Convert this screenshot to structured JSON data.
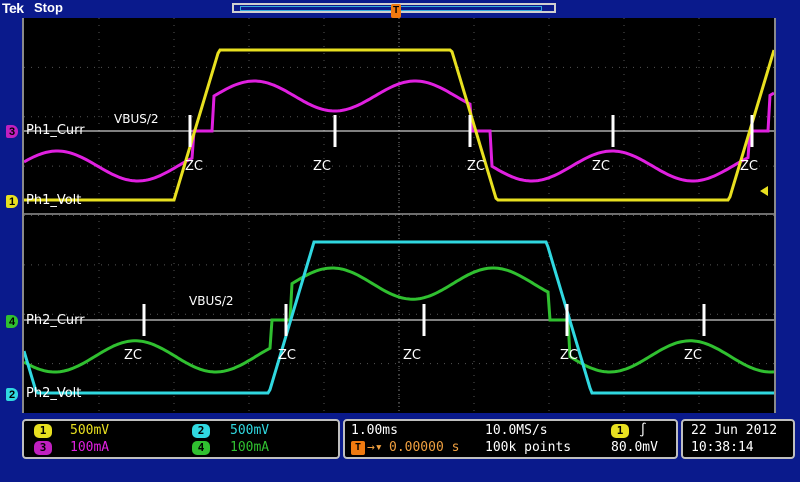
{
  "header": {
    "logo": "Tek",
    "run_state": "Stop"
  },
  "trigger": {
    "marker": "T",
    "pos_marker": "T"
  },
  "channels": {
    "ch3": {
      "number": "3",
      "label": "Ph1_Curr",
      "color": "#e020e0"
    },
    "ch1": {
      "number": "1",
      "label": "Ph1_Volt",
      "color": "#e8e020"
    },
    "ch4": {
      "number": "4",
      "label": "Ph2_Curr",
      "color": "#30c030"
    },
    "ch2": {
      "number": "2",
      "label": "Ph2_Volt",
      "color": "#30d8e0"
    }
  },
  "annotations": {
    "vbus_top": "VBUS/2",
    "vbus_bottom": "VBUS/2",
    "zc": "ZC"
  },
  "status": {
    "ch1_number": "1",
    "ch1_scale": "500mV",
    "ch2_number": "2",
    "ch2_scale": "500mV",
    "ch3_number": "3",
    "ch3_scale": "100mA",
    "ch4_number": "4",
    "ch4_scale": "100mA",
    "timebase": "1.00ms",
    "sample_rate": "10.0MS/s",
    "trigger_delay": "0.00000 s",
    "record_length": "100k points",
    "trigger_source": "1",
    "trigger_level": "80.0mV",
    "date": "22 Jun  2012",
    "time": "10:38:14"
  }
}
